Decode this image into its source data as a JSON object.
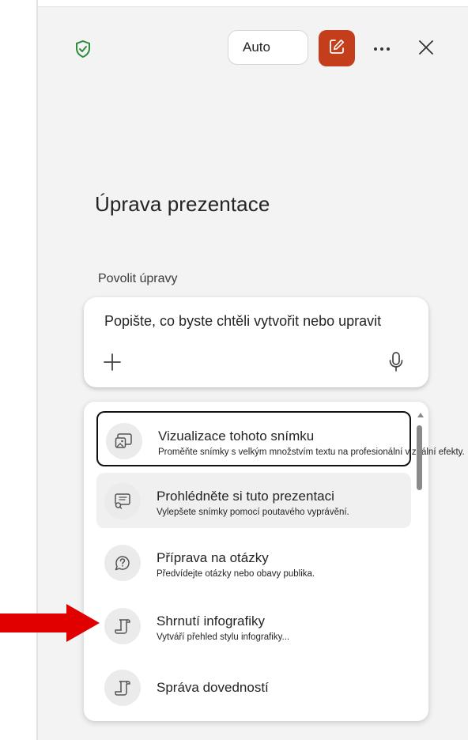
{
  "header": {
    "mode_label": "Auto",
    "icons": {
      "shield": "shield-check-icon",
      "edit": "edit-icon",
      "more": "more-horizontal-icon",
      "close": "close-icon"
    },
    "colors": {
      "shield": "#2e8b3c",
      "edit_bg": "#c43e1c"
    }
  },
  "panel": {
    "title": "Úprava prezentace",
    "enable_label": "Povolit úpravy"
  },
  "prompt": {
    "placeholder": "Popište, co byste chtěli vytvořit nebo upravit",
    "add_icon": "plus-icon",
    "mic_icon": "microphone-icon"
  },
  "menu": {
    "items": [
      {
        "title": "Vizualizace tohoto snímku",
        "desc": "Proměňte snímky s velkým množstvím textu na profesionální vizuální efekty.",
        "icon": "image-slide-icon",
        "state": "selected"
      },
      {
        "title": "Prohlédněte si tuto prezentaci",
        "desc": "Vylepšete snímky pomocí poutavého vyprávění.",
        "icon": "slide-review-icon",
        "state": "hover"
      },
      {
        "title": "Příprava na otázky",
        "desc": "Předvídejte otázky nebo obavy publika.",
        "icon": "question-chat-icon",
        "state": "normal"
      },
      {
        "title": "Shrnutí infografiky",
        "desc": "Vytváří přehled stylu infografiky...",
        "icon": "scroll-icon",
        "state": "normal"
      },
      {
        "title": "Správa dovedností",
        "desc": "",
        "icon": "scroll-icon",
        "state": "normal"
      }
    ]
  },
  "annotation": {
    "arrow_color": "#e00000"
  }
}
